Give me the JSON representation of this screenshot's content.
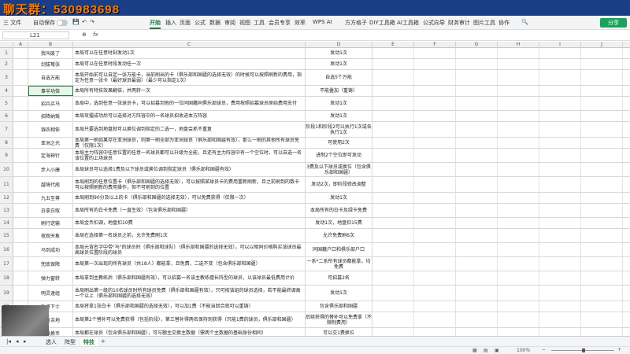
{
  "watermark": "聊天群：530983698",
  "ribbon": {
    "file": "三 文件",
    "autosave": "自动保存",
    "menus": [
      "开始",
      "插入",
      "页面",
      "公式",
      "数据",
      "审阅",
      "视图",
      "工具",
      "会员专享",
      "效率",
      "WPS AI",
      "方方格子",
      "DIY工具箱",
      "AI工具箱",
      "公式向导",
      "财务审计",
      "图片工具",
      "协作"
    ],
    "share": "分享"
  },
  "formula": {
    "cell_ref": "L21",
    "fx": "fx",
    "value": ""
  },
  "columns": [
    "A",
    "B",
    "C",
    "D",
    "E",
    "F",
    "G",
    "H",
    "I",
    "J",
    "K",
    "L"
  ],
  "rows": [
    {
      "num": "1",
      "name": "我叫废了",
      "desc": "本局可以在任意时刻发动1次",
      "effect": "发动1次"
    },
    {
      "num": "2",
      "name": "剑拔弩张",
      "desc": "本局可以在任意时段发动任一次",
      "effect": "发动1次"
    },
    {
      "num": "3",
      "name": "自选万能",
      "desc": "本局开始前可以自定一张万能卡，当前刷出的卡（俱乐部和国疆的选择无效）的时候可以按照刷新的费用，指定为任意一张卡（最好球员最弱）（最少可以指定1次）",
      "effect": "自选5个万能"
    },
    {
      "num": "4",
      "name": "事半功倍",
      "desc": "本局所有特技效果翻倍，并两转一次",
      "effect": "不能叠加（重铸）"
    },
    {
      "num": "5",
      "name": "招兵买马",
      "desc": "本局中，选到任意一张球员卡，可以招募到他的一位同国籍同俱乐部球员，费用按照招募球员原始费用支付",
      "effect": "发动1次"
    },
    {
      "num": "6",
      "name": "招降纳叛",
      "desc": "本局攻擂成功后可以选择对方阵容中的一名球员招收进本方阵容",
      "effect": "发动1次"
    },
    {
      "num": "7",
      "name": "锦衣相依",
      "desc": "本局只要选到地盘就可以换位调到指定的二选一，地盘会抓不重复",
      "effect": "阶段1和阶段2可以执行1次或各执行1次"
    },
    {
      "num": "8",
      "name": "亚洲之光",
      "desc": "本局第一刷如果存在亚洲球员，则第一刷全部为亚洲球员（俱乐部和国疆有效），那么一刷的其他所有球员免费（仅限1次）",
      "effect": "可使用2次"
    },
    {
      "num": "9",
      "name": "定海神针",
      "desc": "本局主力阵容中任意位置的任意一名球员都可以升级为全能，且还有主力阵容中有一个空位时，可以自选一名该位置的上场球员",
      "effect": "进制2个空位即可发动"
    },
    {
      "num": "10",
      "name": "步入小康",
      "desc": "本局球员可以选择1费及以下球员或换位调到指定球员（俱乐部和国疆有效）",
      "effect": "3费及以下球员或换位（包含俱乐部和国疆）"
    },
    {
      "num": "11",
      "name": "越境代庖",
      "desc": "本局刷到的任意位置卡（俱乐部和国疆的选择无效），可以按照某球员卡的费用重新刷新，且之前刷到的数卡可以按照刷新的费用操作，但不可刷到的位置",
      "effect": "发动2次，即阶段修改调整"
    },
    {
      "num": "12",
      "name": "九五至尊",
      "desc": "本局刷到90分及以上的卡（俱乐部和国疆的选择无效），可以免费获得（仅限一次）",
      "effect": "发动1次"
    },
    {
      "num": "13",
      "name": "白拿白取",
      "desc": "本局所有的白卡免费（一直生效）（包含俱乐部和国疆）",
      "effect": "本局所有的白卡及绿卡免费"
    },
    {
      "num": "14",
      "name": "刷行逆输",
      "desc": "本局金币扣调，地盘扣10费",
      "effect": "发动1次，地盘扣15费"
    },
    {
      "num": "15",
      "name": "夜观天象",
      "desc": "本局在选择第一名球员之前，允许免费刷1次",
      "effect": "允许免费刷6次"
    },
    {
      "num": "16",
      "name": "马到成功",
      "desc": "本局元宵名字中带\"马\"的球员时（俱乐部和球队）（俱乐部和国疆的选择无效），可以以相同价格购买该球员最高球员位置阶段的球员",
      "effect": "同国籍户口和俱乐部户口"
    },
    {
      "num": "17",
      "name": "兜底保障",
      "desc": "本局第一次出现的所有球员（共18人）都能拿，且免费，二选不变（包含俱乐部和国疆）",
      "effect": "一系*二系所有球员都能拿，均免费"
    },
    {
      "num": "18",
      "name": "弹力窗转",
      "desc": "本局拿到主教练后（俱乐部和国疆有效），可以招募一名该主教练擅长阵型的球员，以该球员最低费用计价",
      "effect": "可招募2名"
    },
    {
      "num": "19",
      "name": "明灵速组",
      "desc": "本局刷出第一级的10名球员时所有球员免费（俱乐部和国疆有效），只可按该组的球员选择，若不能最终调高一个以上（俱乐部和国疆的选择无效）",
      "effect": "发动1次"
    },
    {
      "num": "20",
      "name": "礼贤下士",
      "desc": "本局将拿1张白卡（俱乐部和国疆的选择无效），可以加1费（不能当回合就可以重铸）",
      "effect": "包含俱乐部和国疆"
    },
    {
      "num": "21",
      "name": "诸有余地",
      "desc": "本局第2个替补可以免费获得（包括阶段），第三替补得两名保持到获得（只能1费的球员，俱乐部和国疆）",
      "effect": "后续获得的替补可以免费拿（不限制费用）"
    },
    {
      "num": "22",
      "name": "顶格换币",
      "desc": "本局都在球员（包含俱乐部和国疆），可与额主交换主数据（需两个主数据的基础身份相同）",
      "effect": "可以交1费换位"
    }
  ],
  "sheet_tabs": [
    "选人",
    "阵型",
    "特技"
  ],
  "active_tab": "特技",
  "zoom": "100%"
}
